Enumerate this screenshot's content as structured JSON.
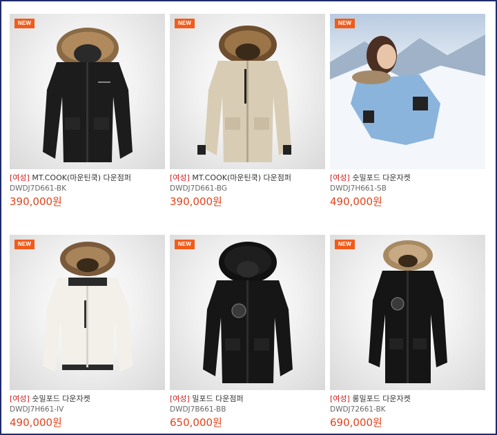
{
  "products": [
    {
      "badge": "NEW",
      "tag": "[여성]",
      "name": "MT.COOK(마운틴쿡) 다운점퍼",
      "code": "DWDJ7D661-BK",
      "price": "390,000원",
      "image": "black-parka-with-fur-hood"
    },
    {
      "badge": "NEW",
      "tag": "[여성]",
      "name": "MT.COOK(마운틴쿡) 다운점퍼",
      "code": "DWDJ7D661-BG",
      "price": "390,000원",
      "image": "beige-parka-with-fur-hood"
    },
    {
      "badge": "NEW",
      "tag": "[여성]",
      "name": "숏밀포드 다운자켓",
      "code": "DWDJ7H661-SB",
      "price": "490,000원",
      "image": "model-in-light-blue-jacket-snow"
    },
    {
      "badge": "NEW",
      "tag": "[여성]",
      "name": "숏밀포드 다운자켓",
      "code": "DWDJ7H661-IV",
      "price": "490,000원",
      "image": "ivory-short-jacket-with-fur-hood"
    },
    {
      "badge": "NEW",
      "tag": "[여성]",
      "name": "밀포드 다운점퍼",
      "code": "DWDJ7B661-BB",
      "price": "650,000원",
      "image": "black-parka-black-fur-hood"
    },
    {
      "badge": "NEW",
      "tag": "[여성]",
      "name": "롱밀포드 다운자켓",
      "code": "DWDJ72661-BK",
      "price": "690,000원",
      "image": "black-long-down-jacket-fur-hood"
    }
  ]
}
